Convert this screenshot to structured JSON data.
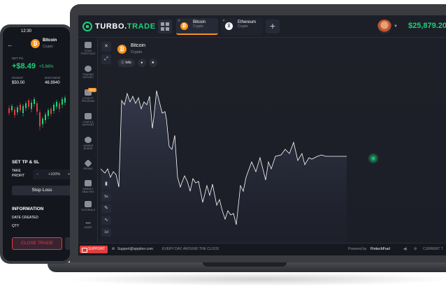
{
  "laptop": {
    "brand": {
      "prefix": "TURBO.",
      "suffix": "TRADE"
    },
    "tabs": [
      {
        "name": "Bitcoin",
        "type": "Crypto",
        "coin": "₿",
        "active": true
      },
      {
        "name": "Ethereum",
        "type": "Crypto",
        "coin": "Ξ",
        "active": false
      }
    ],
    "balance": "$25,879.20",
    "left_nav": [
      {
        "label": "TOTAL PORTFOLIO"
      },
      {
        "label": "TRADING HISTORY"
      },
      {
        "label": "LOYALTY PROGRAM",
        "badge": "NEW"
      },
      {
        "label": "CHATS & SUPPORT"
      },
      {
        "label": "LEADER BOARD"
      },
      {
        "label": "PROMO"
      },
      {
        "label": "MARKET ANALYSIS"
      },
      {
        "label": "TUTORIALS"
      },
      {
        "label": "MORE"
      }
    ],
    "tools": [
      "5s",
      "1d"
    ],
    "asset": {
      "name": "Bitcoin",
      "type": "Crypto",
      "info_label": "Info"
    },
    "footer": {
      "support": "SUPPORT",
      "email": "Support@iqoption.com",
      "hours": "EVERY DAY, AROUND THE CLOCK",
      "powered": "Powered by",
      "provider": "FintechFuel",
      "current": "CURRENT T"
    },
    "colors": {
      "accent": "#19d27a",
      "bitcoin": "#f7931a",
      "support": "#e23d3d"
    }
  },
  "phone": {
    "time": "12:30",
    "asset_name": "Bitcoin",
    "asset_type": "Crypto",
    "net_pnl_label": "NET P/L",
    "net_pnl": "+$8.49",
    "net_pnl_pct": "+5.66%",
    "invest_label": "INVEST",
    "invest": "$50.00",
    "distance_label": "DISTANCE",
    "distance": "46.9940",
    "set_tp_sl": "SET TP & SL",
    "take_profit": "TAKE PROFIT",
    "stepper_minus": "−",
    "stepper_value": "+100%",
    "stepper_plus": "+",
    "stop_loss": "Stop Loss",
    "information": "INFORMATION",
    "date_created": "DATE CREATED",
    "qty": "QTY",
    "close_trade": "CLOSE TRADE"
  }
}
